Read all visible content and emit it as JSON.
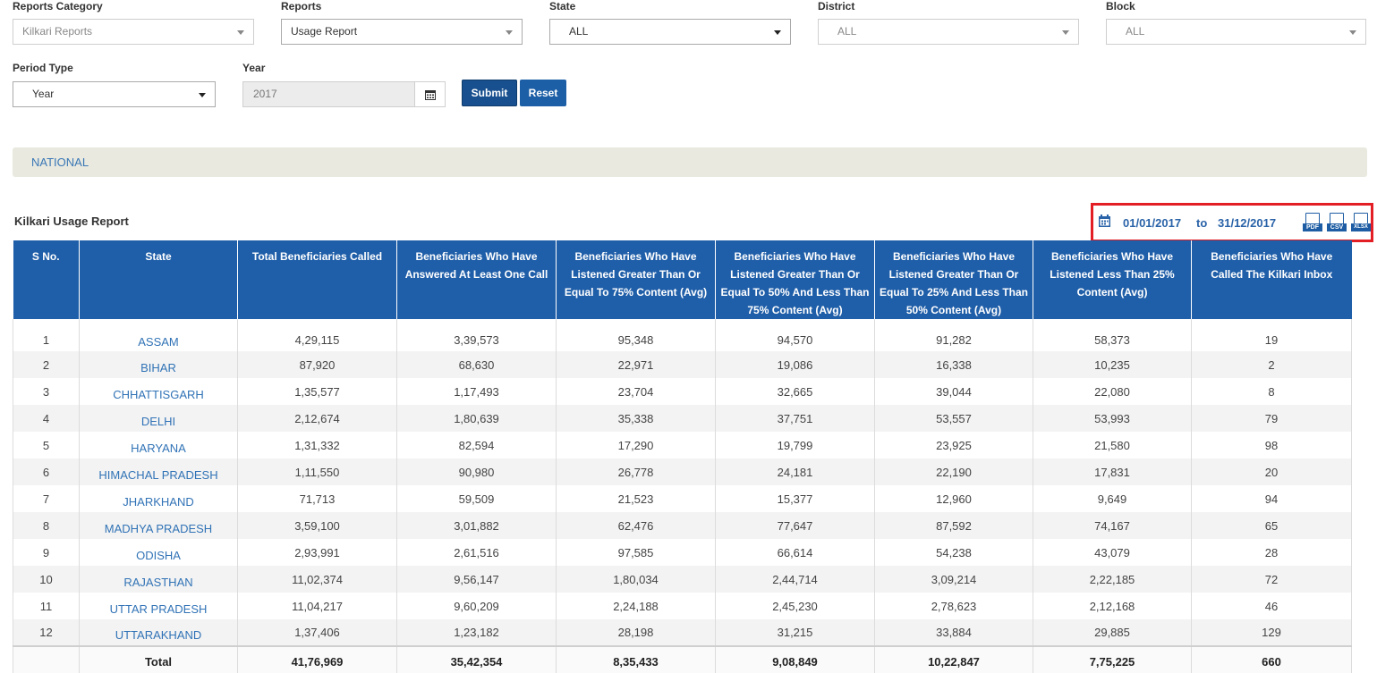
{
  "filters": {
    "reports_category": {
      "label": "Reports Category",
      "value": "Kilkari Reports"
    },
    "reports": {
      "label": "Reports",
      "value": "Usage Report"
    },
    "state": {
      "label": "State",
      "value": "ALL"
    },
    "district": {
      "label": "District",
      "value": "ALL"
    },
    "block": {
      "label": "Block",
      "value": "ALL"
    },
    "period_type": {
      "label": "Period Type",
      "value": "Year"
    },
    "year": {
      "label": "Year",
      "value": "2017"
    }
  },
  "buttons": {
    "submit": "Submit",
    "reset": "Reset"
  },
  "breadcrumb": "NATIONAL",
  "report": {
    "title": "Kilkari Usage Report",
    "date_from": "01/01/2017",
    "date_to_label": "to",
    "date_to": "31/12/2017",
    "exports": [
      "PDF",
      "CSV",
      "XLSX"
    ]
  },
  "table": {
    "headers": [
      "S No.",
      "State",
      "Total Beneficiaries Called",
      "Beneficiaries Who Have Answered At Least One Call",
      "Beneficiaries Who Have Listened Greater Than Or Equal To 75% Content (Avg)",
      "Beneficiaries Who Have Listened Greater Than Or Equal To 50% And Less Than 75% Content (Avg)",
      "Beneficiaries Who Have Listened Greater Than Or Equal To 25% And Less Than 50% Content (Avg)",
      "Beneficiaries Who Have Listened Less Than 25% Content (Avg)",
      "Beneficiaries Who Have Called The Kilkari Inbox"
    ],
    "rows": [
      [
        "1",
        "ASSAM",
        "4,29,115",
        "3,39,573",
        "95,348",
        "94,570",
        "91,282",
        "58,373",
        "19"
      ],
      [
        "2",
        "BIHAR",
        "87,920",
        "68,630",
        "22,971",
        "19,086",
        "16,338",
        "10,235",
        "2"
      ],
      [
        "3",
        "CHHATTISGARH",
        "1,35,577",
        "1,17,493",
        "23,704",
        "32,665",
        "39,044",
        "22,080",
        "8"
      ],
      [
        "4",
        "DELHI",
        "2,12,674",
        "1,80,639",
        "35,338",
        "37,751",
        "53,557",
        "53,993",
        "79"
      ],
      [
        "5",
        "HARYANA",
        "1,31,332",
        "82,594",
        "17,290",
        "19,799",
        "23,925",
        "21,580",
        "98"
      ],
      [
        "6",
        "HIMACHAL PRADESH",
        "1,11,550",
        "90,980",
        "26,778",
        "24,181",
        "22,190",
        "17,831",
        "20"
      ],
      [
        "7",
        "JHARKHAND",
        "71,713",
        "59,509",
        "21,523",
        "15,377",
        "12,960",
        "9,649",
        "94"
      ],
      [
        "8",
        "MADHYA PRADESH",
        "3,59,100",
        "3,01,882",
        "62,476",
        "77,647",
        "87,592",
        "74,167",
        "65"
      ],
      [
        "9",
        "ODISHA",
        "2,93,991",
        "2,61,516",
        "97,585",
        "66,614",
        "54,238",
        "43,079",
        "28"
      ],
      [
        "10",
        "RAJASTHAN",
        "11,02,374",
        "9,56,147",
        "1,80,034",
        "2,44,714",
        "3,09,214",
        "2,22,185",
        "72"
      ],
      [
        "11",
        "UTTAR PRADESH",
        "11,04,217",
        "9,60,209",
        "2,24,188",
        "2,45,230",
        "2,78,623",
        "2,12,168",
        "46"
      ],
      [
        "12",
        "UTTARAKHAND",
        "1,37,406",
        "1,23,182",
        "28,198",
        "31,215",
        "33,884",
        "29,885",
        "129"
      ]
    ],
    "total": [
      "",
      "Total",
      "41,76,969",
      "35,42,354",
      "8,35,433",
      "9,08,849",
      "10,22,847",
      "7,75,225",
      "660"
    ]
  },
  "icons": {
    "calendar": "calendar-icon",
    "caret": "caret-down-icon"
  },
  "colors": {
    "primary": "#1f5ea8",
    "link": "#3173b6",
    "highlight": "#e31e24"
  }
}
